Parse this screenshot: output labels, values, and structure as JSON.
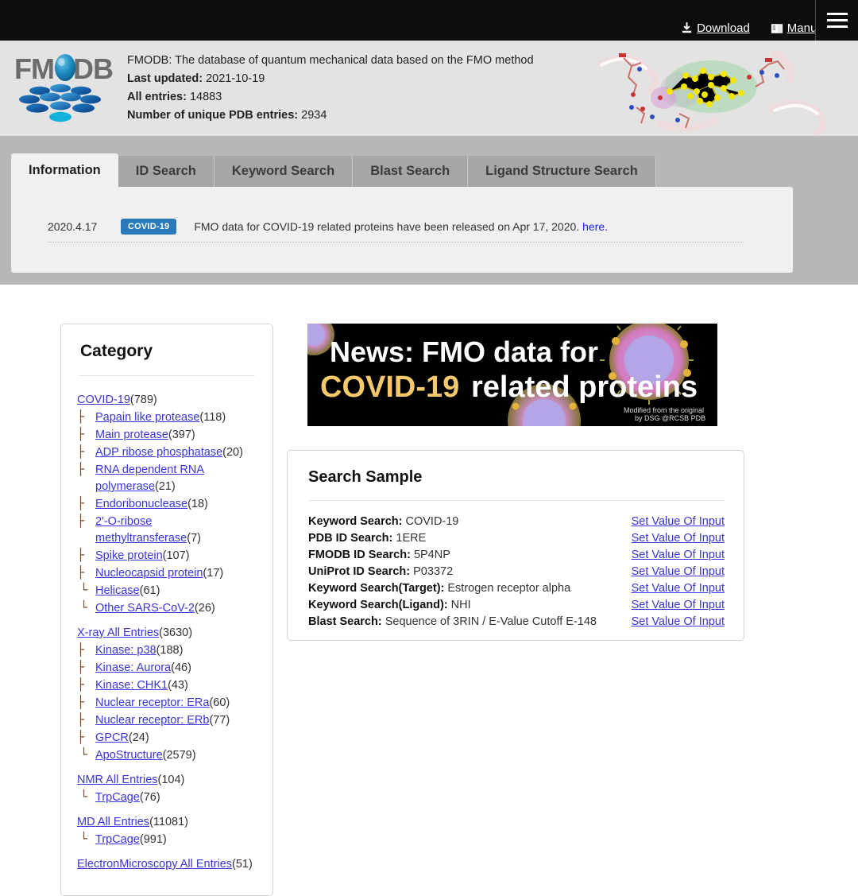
{
  "topbar": {
    "download_label": "Download",
    "manual_label": "Manual",
    "menu_label": "Menu"
  },
  "header": {
    "logo_text": "FMODB",
    "tagline": "FMODB: The database of quantum mechanical data based on the FMO method",
    "last_updated_label": "Last updated:",
    "last_updated_value": "2021-10-19",
    "all_entries_label": "All entries:",
    "all_entries_value": "14883",
    "unique_pdb_label": "Number of unique PDB entries:",
    "unique_pdb_value": "2934"
  },
  "tabs": [
    {
      "label": "Information",
      "active": true
    },
    {
      "label": "ID Search",
      "active": false
    },
    {
      "label": "Keyword Search",
      "active": false
    },
    {
      "label": "Blast Search",
      "active": false
    },
    {
      "label": "Ligand Structure Search",
      "active": false
    }
  ],
  "information": {
    "news": {
      "date": "2020.4.17",
      "badge": "COVID-19",
      "text": "FMO data for COVID-19 related proteins have been released on Apr 17, 2020.",
      "link_text": "here."
    }
  },
  "category": {
    "title": "Category",
    "groups": [
      {
        "root": {
          "label": "COVID-19",
          "count": "(789)"
        },
        "children": [
          {
            "branch": "├",
            "label": "Papain like protease",
            "count": "(118)"
          },
          {
            "branch": "├",
            "label": "Main protease",
            "count": "(397)"
          },
          {
            "branch": "├",
            "label": "ADP ribose phosphatase",
            "count": "(20)"
          },
          {
            "branch": "├",
            "label": "RNA dependent RNA polymerase",
            "count": "(21)"
          },
          {
            "branch": "├",
            "label": "Endoribonuclease",
            "count": "(18)"
          },
          {
            "branch": "├",
            "label": "2'-O-ribose methyltransferase",
            "count": "(7)"
          },
          {
            "branch": "├",
            "label": "Spike protein",
            "count": "(107)"
          },
          {
            "branch": "├",
            "label": "Nucleocapsid protein",
            "count": "(17)"
          },
          {
            "branch": "└",
            "label": "Helicase",
            "count": "(61)"
          },
          {
            "branch": "└",
            "label": "Other SARS-CoV-2",
            "count": "(26)"
          }
        ]
      },
      {
        "root": {
          "label": "X-ray All Entries",
          "count": "(3630)"
        },
        "children": [
          {
            "branch": "├",
            "label": "Kinase: p38",
            "count": "(188)"
          },
          {
            "branch": "├",
            "label": "Kinase: Aurora",
            "count": "(46)"
          },
          {
            "branch": "├",
            "label": "Kinase: CHK1",
            "count": "(43)"
          },
          {
            "branch": "├",
            "label": "Nuclear receptor: ERa",
            "count": "(60)"
          },
          {
            "branch": "├",
            "label": "Nuclear receptor: ERb",
            "count": "(77)"
          },
          {
            "branch": "├",
            "label": "GPCR",
            "count": "(24)"
          },
          {
            "branch": "└",
            "label": "ApoStructure",
            "count": "(2579)"
          }
        ]
      },
      {
        "root": {
          "label": "NMR All Entries",
          "count": "(104)"
        },
        "children": [
          {
            "branch": "└",
            "label": "TrpCage",
            "count": "(76)"
          }
        ]
      },
      {
        "root": {
          "label": "MD All Entries",
          "count": "(11081)"
        },
        "children": [
          {
            "branch": "└",
            "label": "TrpCage",
            "count": "(991)"
          }
        ]
      },
      {
        "root": {
          "label": "ElectronMicroscopy All Entries",
          "count": "(51)"
        },
        "children": []
      }
    ]
  },
  "news_banner": {
    "line1": "News: FMO data for",
    "line2_highlight": "COVID-19",
    "line2_rest": "related proteins",
    "credit_line1": "Modified from the original",
    "credit_line2": "by DSG @RCSB PDB"
  },
  "search_sample": {
    "title": "Search Sample",
    "link_label": "Set Value Of Input",
    "rows": [
      {
        "label": "Keyword Search:",
        "value": "COVID-19"
      },
      {
        "label": "PDB ID Search:",
        "value": "1ERE"
      },
      {
        "label": "FMODB ID Search:",
        "value": "5P4NP"
      },
      {
        "label": "UniProt ID Search:",
        "value": "P03372"
      },
      {
        "label": "Keyword Search(Target):",
        "value": "Estrogen receptor alpha"
      },
      {
        "label": "Keyword Search(Ligand):",
        "value": "NHI"
      },
      {
        "label": "Blast Search:",
        "value": "Sequence of 3RIN / E-Value Cutoff E-148"
      }
    ]
  },
  "colors": {
    "topbar_bg": "#0d0d0d",
    "header_bg": "#e3e3e3",
    "tabzone_bg": "#b7b7b7",
    "tab_active_bg": "#f0f0f0",
    "tab_inactive_bg": "#a6a6a6",
    "badge_blue": "#2a7ab9",
    "link_blue": "#3a35d8",
    "banner_highlight": "#f5c96a"
  }
}
